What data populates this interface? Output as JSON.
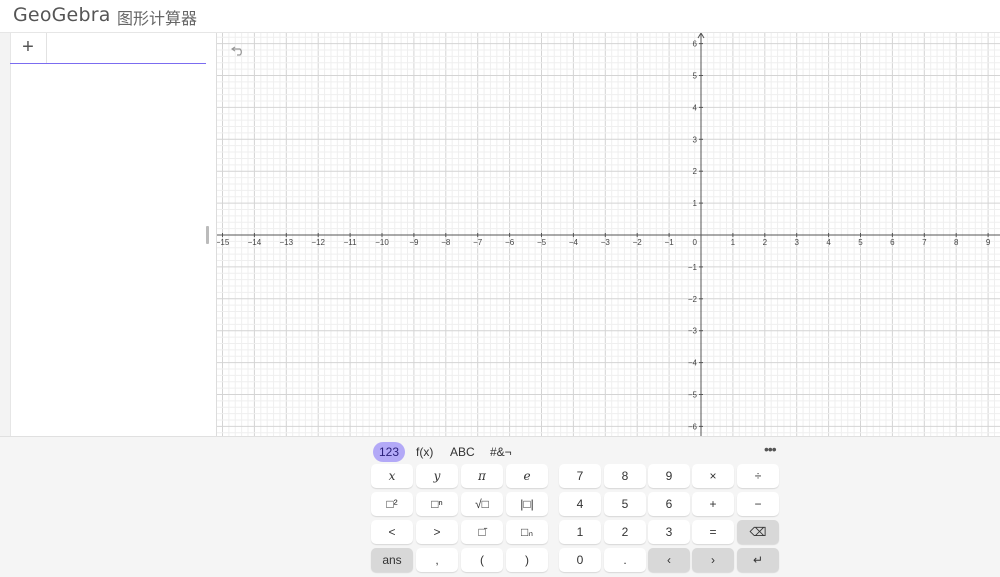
{
  "header": {
    "logo": "GeoGebra",
    "app_title": "图形计算器"
  },
  "algebra": {
    "add_label": "+"
  },
  "graph": {
    "x_ticks": [
      "−15",
      "−14",
      "−13",
      "−12",
      "−11",
      "−10",
      "−9",
      "−8",
      "−7",
      "−6",
      "−5",
      "−4",
      "−3",
      "−2",
      "−1",
      "0",
      "1",
      "2",
      "3",
      "4",
      "5",
      "6",
      "7",
      "8",
      "9"
    ],
    "y_ticks": [
      "6",
      "5",
      "4",
      "3",
      "2",
      "1",
      "−1",
      "−2",
      "−3",
      "−4",
      "−5",
      "−6"
    ],
    "undo_icon": "undo-icon"
  },
  "keyboard": {
    "tabs": [
      "123",
      "f(x)",
      "ABC",
      "#&¬"
    ],
    "active_tab": "123",
    "more": "•••",
    "rows": [
      [
        "x",
        "y",
        "π",
        "e",
        "7",
        "8",
        "9",
        "×",
        "÷"
      ],
      [
        "□²",
        "□ⁿ",
        "√□",
        "|□|",
        "4",
        "5",
        "6",
        "+",
        "−"
      ],
      [
        "<",
        ">",
        "□̄",
        "□ₙ",
        "1",
        "2",
        "3",
        "=",
        "⌫"
      ],
      [
        "ans",
        ",",
        "(",
        ")",
        "0",
        ".",
        "‹",
        "›",
        "↵"
      ]
    ],
    "accent": "#b3a9f7"
  }
}
